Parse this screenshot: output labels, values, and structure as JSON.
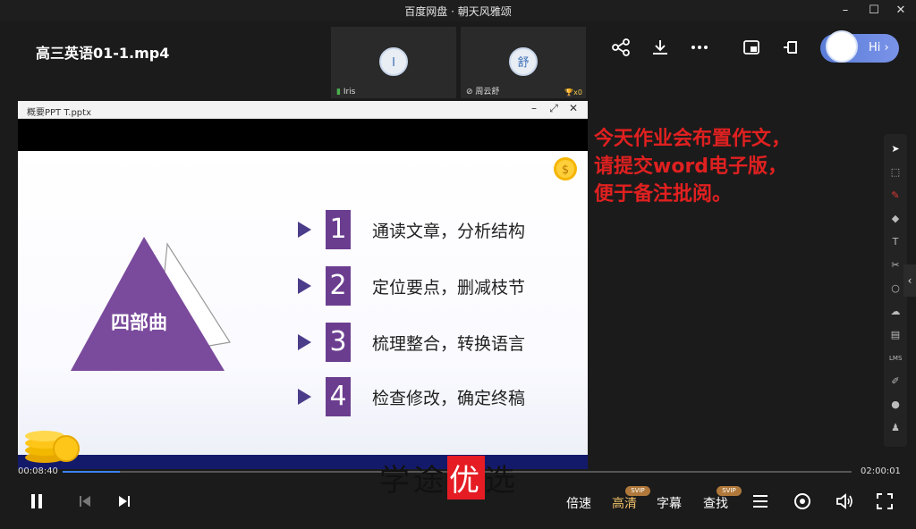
{
  "window": {
    "title": "百度网盘 · 朝天风雅颂"
  },
  "video": {
    "title": "高三英语01-1.mp4"
  },
  "participants": [
    {
      "initial": "I",
      "name": "Iris"
    },
    {
      "initial": "舒",
      "name": "周云舒",
      "badge": "x0"
    }
  ],
  "hi_button": {
    "label": "Hi ›"
  },
  "ppt_window": {
    "filename": "概要PPT T.pptx"
  },
  "slide": {
    "triangle_label": "四部曲",
    "items": [
      {
        "num": "1",
        "text": "通读文章，分析结构"
      },
      {
        "num": "2",
        "text": "定位要点，删减枝节"
      },
      {
        "num": "3",
        "text": "梳理整合，转换语言"
      },
      {
        "num": "4",
        "text": "检查修改，确定终稿"
      }
    ]
  },
  "note": {
    "line1": "今天作业会布置作文，",
    "line2": "请提交word电子版，",
    "line3": "便于备注批阅。"
  },
  "player": {
    "current_time": "00:08:40",
    "total_time": "02:00:01",
    "progress": 0.072,
    "speed_label": "倍速",
    "quality_label": "高清",
    "subtitle_label": "字幕",
    "search_label": "查找",
    "svip": "SVIP"
  },
  "watermark": {
    "part1": "学",
    "part2": "途",
    "part3": "优",
    "part4": "选"
  },
  "colors": {
    "accent": "#3b82f6",
    "note_red": "#e02020",
    "slide_purple": "#6b3d8f",
    "footer_navy": "#141a6a"
  }
}
